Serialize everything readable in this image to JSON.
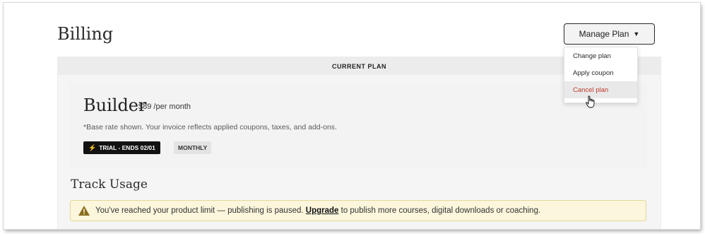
{
  "page": {
    "title": "Billing"
  },
  "header": {
    "manage_plan_label": "Manage Plan"
  },
  "manage_menu": {
    "items": [
      {
        "label": "Change plan"
      },
      {
        "label": "Apply coupon"
      },
      {
        "label": "Cancel plan"
      }
    ]
  },
  "current_plan": {
    "header": "CURRENT PLAN",
    "name": "Builder",
    "price": "$89 /per month",
    "note": "*Base rate shown. Your invoice reflects applied coupons, taxes, and add-ons.",
    "trial_badge": "TRIAL - ENDS 02/01",
    "billing_badge": "MONTHLY"
  },
  "usage": {
    "title": "Track Usage",
    "alert": {
      "prefix": "You've reached your product limit — publishing is paused.",
      "link": "Upgrade",
      "suffix": "to publish more courses, digital downloads or coaching."
    }
  },
  "icons": {
    "chevron": "chevron-down-icon",
    "bolt": "lightning-icon",
    "warning": "warning-icon",
    "cursor": "hand-pointer-icon"
  },
  "colors": {
    "danger": "#c0392b",
    "alert_bg": "#fcf6dc",
    "alert_border": "#e3d89a",
    "trial_bg": "#121212",
    "bolt": "#f0c419"
  }
}
